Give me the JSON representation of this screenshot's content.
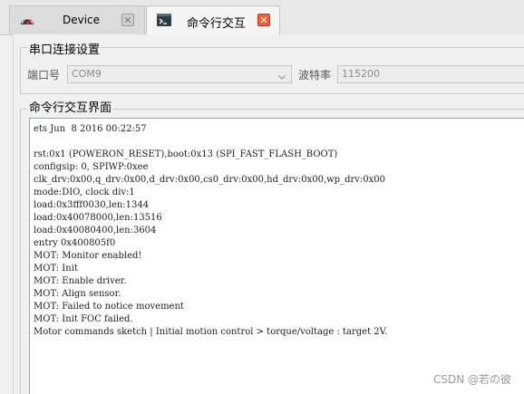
{
  "tabs": [
    {
      "label": "Device",
      "icon": "speedometer-icon",
      "active": false
    },
    {
      "label": "命令行交互",
      "icon": "terminal-icon",
      "active": true
    }
  ],
  "serial": {
    "group_title": "串口连接设置",
    "port_label": "端口号",
    "port_value": "COM9",
    "baud_label": "波特率",
    "baud_value": "115200"
  },
  "console": {
    "group_title": "命令行交互界面",
    "lines": [
      "ets Jun  8 2016 00:22:57",
      "",
      "rst:0x1 (POWERON_RESET),boot:0x13 (SPI_FAST_FLASH_BOOT)",
      "configsip: 0, SPIWP:0xee",
      "clk_drv:0x00,q_drv:0x00,d_drv:0x00,cs0_drv:0x00,hd_drv:0x00,wp_drv:0x00",
      "mode:DIO, clock div:1",
      "load:0x3fff0030,len:1344",
      "load:0x40078000,len:13516",
      "load:0x40080400,len:3604",
      "entry 0x400805f0",
      "MOT: Monitor enabled!",
      "MOT: Init",
      "MOT: Enable driver.",
      "MOT: Align sensor.",
      "MOT: Failed to notice movement",
      "MOT: Init FOC failed.",
      "Motor commands sketch | Initial motion control > torque/voltage : target 2V."
    ]
  },
  "watermark": "CSDN @若の彼"
}
